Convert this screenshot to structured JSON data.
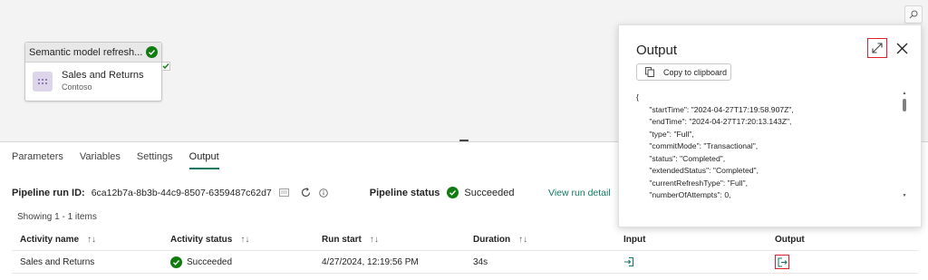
{
  "canvas": {
    "node": {
      "header_title": "Semantic model refresh...",
      "title": "Sales and Returns",
      "subtitle": "Contoso"
    }
  },
  "tabs": [
    {
      "label": "Parameters"
    },
    {
      "label": "Variables"
    },
    {
      "label": "Settings"
    },
    {
      "label": "Output",
      "active": true
    }
  ],
  "run": {
    "id_label": "Pipeline run ID:",
    "id_value": "6ca12b7a-8b3b-44c9-8507-6359487c62d7",
    "status_label": "Pipeline status",
    "status_value": "Succeeded",
    "view_link": "View run detail"
  },
  "showing": "Showing 1 - 1 items",
  "table": {
    "headers": [
      "Activity name",
      "Activity status",
      "Run start",
      "Duration",
      "Input",
      "Output"
    ],
    "rows": [
      {
        "activity_name": "Sales and Returns",
        "status": "Succeeded",
        "run_start": "4/27/2024, 12:19:56 PM",
        "duration": "34s"
      }
    ]
  },
  "popup": {
    "title": "Output",
    "copy_label": "Copy to clipboard",
    "code": "{\n      \"startTime\": \"2024-04-27T17:19:58.907Z\",\n      \"endTime\": \"2024-04-27T17:20:13.143Z\",\n      \"type\": \"Full\",\n      \"commitMode\": \"Transactional\",\n      \"status\": \"Completed\",\n      \"extendedStatus\": \"Completed\",\n      \"currentRefreshType\": \"Full\",\n      \"numberOfAttempts\": 0,"
  },
  "colors": {
    "success": "#107c10",
    "accent": "#117865",
    "highlight": "#e0202b"
  }
}
